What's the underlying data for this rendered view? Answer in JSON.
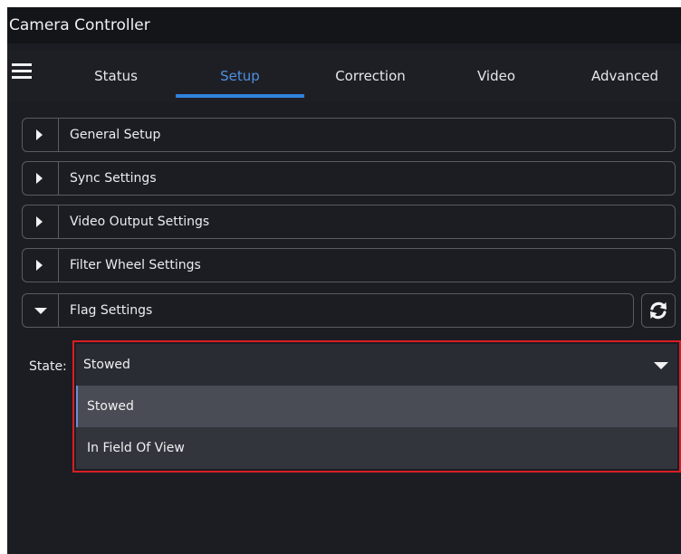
{
  "window": {
    "title": "Camera Controller"
  },
  "nav": {
    "menu_icon": "hamburger-icon",
    "tabs": [
      {
        "label": "Status"
      },
      {
        "label": "Setup",
        "active": true
      },
      {
        "label": "Correction"
      },
      {
        "label": "Video"
      },
      {
        "label": "Advanced"
      }
    ]
  },
  "sections": [
    {
      "label": "General Setup",
      "expanded": false
    },
    {
      "label": "Sync Settings",
      "expanded": false
    },
    {
      "label": "Video Output Settings",
      "expanded": false
    },
    {
      "label": "Filter Wheel Settings",
      "expanded": false
    },
    {
      "label": "Flag Settings",
      "expanded": true
    }
  ],
  "flag_settings": {
    "refresh_icon": "refresh-icon",
    "state_label": "State:",
    "state_value": "Stowed",
    "options": [
      "Stowed",
      "In Field Of View"
    ],
    "selected_option": "Stowed"
  },
  "colors": {
    "accent": "#2f82dc",
    "highlight_outline": "#d81e24",
    "background": "#1c1d23"
  }
}
